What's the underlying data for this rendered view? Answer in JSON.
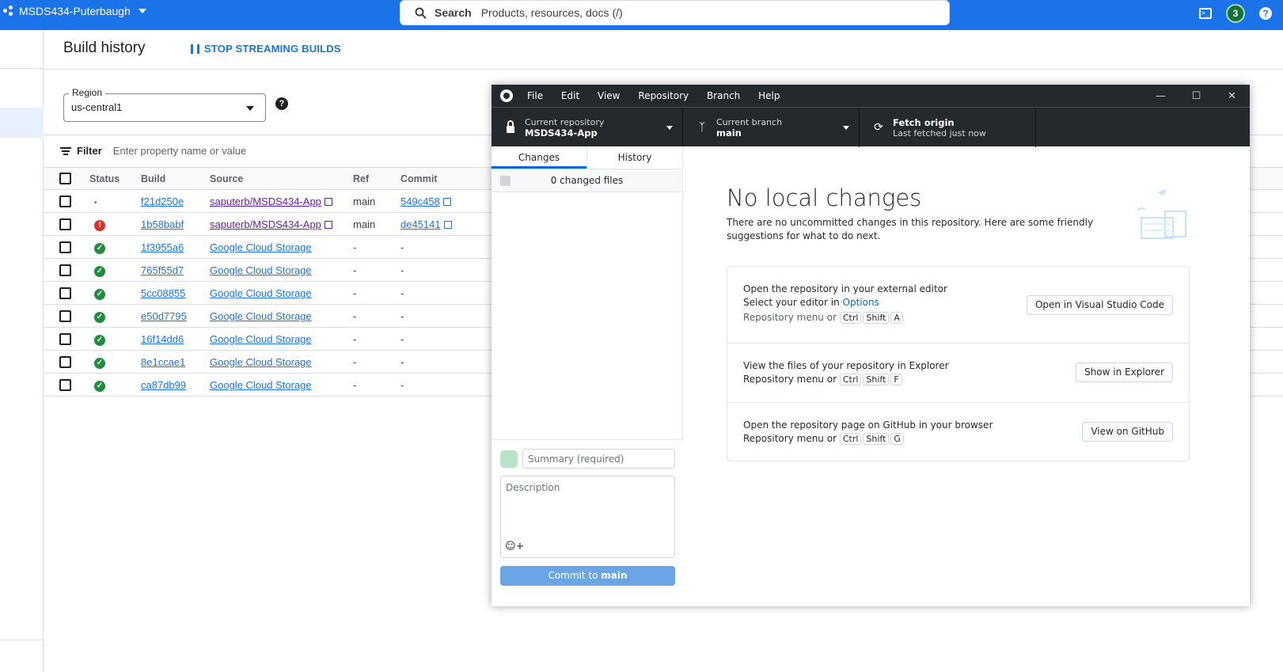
{
  "topbar": {
    "project": "MSDS434-Puterbaugh",
    "search_label": "Search",
    "search_placeholder": "Products, resources, docs (/)",
    "notification_count": "3",
    "help": "?"
  },
  "page": {
    "title": "Build history",
    "stop_streaming": "STOP STREAMING BUILDS",
    "region_label": "Region",
    "region_value": "us-central1",
    "filter_label": "Filter",
    "filter_placeholder": "Enter property name or value"
  },
  "table": {
    "headers": [
      "Status",
      "Build",
      "Source",
      "Ref",
      "Commit"
    ],
    "rows": [
      {
        "status": "pending",
        "build": "f21d250e",
        "source": "saputerb/MSDS434-App",
        "ref": "main",
        "commit": "549c458"
      },
      {
        "status": "error",
        "build": "1b58babf",
        "source": "saputerb/MSDS434-App",
        "ref": "main",
        "commit": "de45141"
      },
      {
        "status": "success",
        "build": "1f3955a6",
        "source": "Google Cloud Storage",
        "ref": "-",
        "commit": "-"
      },
      {
        "status": "success",
        "build": "765f55d7",
        "source": "Google Cloud Storage",
        "ref": "-",
        "commit": "-"
      },
      {
        "status": "success",
        "build": "5cc08855",
        "source": "Google Cloud Storage",
        "ref": "-",
        "commit": "-"
      },
      {
        "status": "success",
        "build": "e50d7795",
        "source": "Google Cloud Storage",
        "ref": "-",
        "commit": "-"
      },
      {
        "status": "success",
        "build": "16f14dd6",
        "source": "Google Cloud Storage",
        "ref": "-",
        "commit": "-"
      },
      {
        "status": "success",
        "build": "8e1ccae1",
        "source": "Google Cloud Storage",
        "ref": "-",
        "commit": "-"
      },
      {
        "status": "success",
        "build": "ca87db99",
        "source": "Google Cloud Storage",
        "ref": "-",
        "commit": "-"
      }
    ]
  },
  "colors": {
    "gcp_blue": "#1a73e8",
    "success": "#1e8e3e",
    "error": "#d93025",
    "gh_dark": "#24292e"
  },
  "github": {
    "menu": [
      "File",
      "Edit",
      "View",
      "Repository",
      "Branch",
      "Help"
    ],
    "repo_label": "Current repository",
    "repo_value": "MSDS434-App",
    "branch_label": "Current branch",
    "branch_value": "main",
    "fetch_label": "Fetch origin",
    "fetch_sub": "Last fetched just now",
    "tab_changes": "Changes",
    "tab_history": "History",
    "changed_files": "0 changed files",
    "summary_placeholder": "Summary (required)",
    "description_placeholder": "Description",
    "commit_prefix": "Commit to",
    "commit_branch": "main",
    "heading": "No local changes",
    "subtext": "There are no uncommitted changes in this repository. Here are some friendly suggestions for what to do next.",
    "s1_title": "Open the repository in your external editor",
    "s1_sub": "Select your editor in",
    "s1_link": "Options",
    "s1_btn": "Open in Visual Studio Code",
    "s2_title": "View the files of your repository in Explorer",
    "s2_btn": "Show in Explorer",
    "s3_title": "Open the repository page on GitHub in your browser",
    "s3_btn": "View on GitHub",
    "menu_or": "Repository menu or",
    "key_ctrl": "Ctrl",
    "key_shift": "Shift",
    "key_a": "A",
    "key_f": "F",
    "key_g": "G"
  }
}
